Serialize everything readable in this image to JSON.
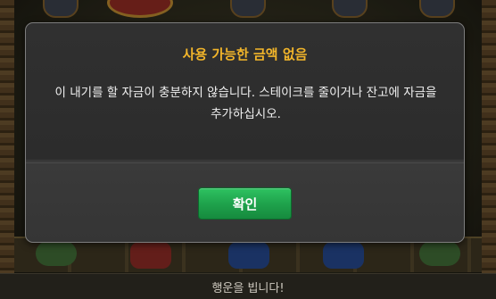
{
  "dialog": {
    "title": "사용 가능한 금액 없음",
    "message": "이 내기를 할 자금이 충분하지 않습니다. 스테이크를 줄이거나 잔고에 자금을 추가하십시오.",
    "confirm_label": "확인"
  },
  "status_bar": {
    "text": "행운을 빕니다!"
  },
  "colors": {
    "title": "#f2b52a",
    "confirm_button": "#1fa34c"
  }
}
